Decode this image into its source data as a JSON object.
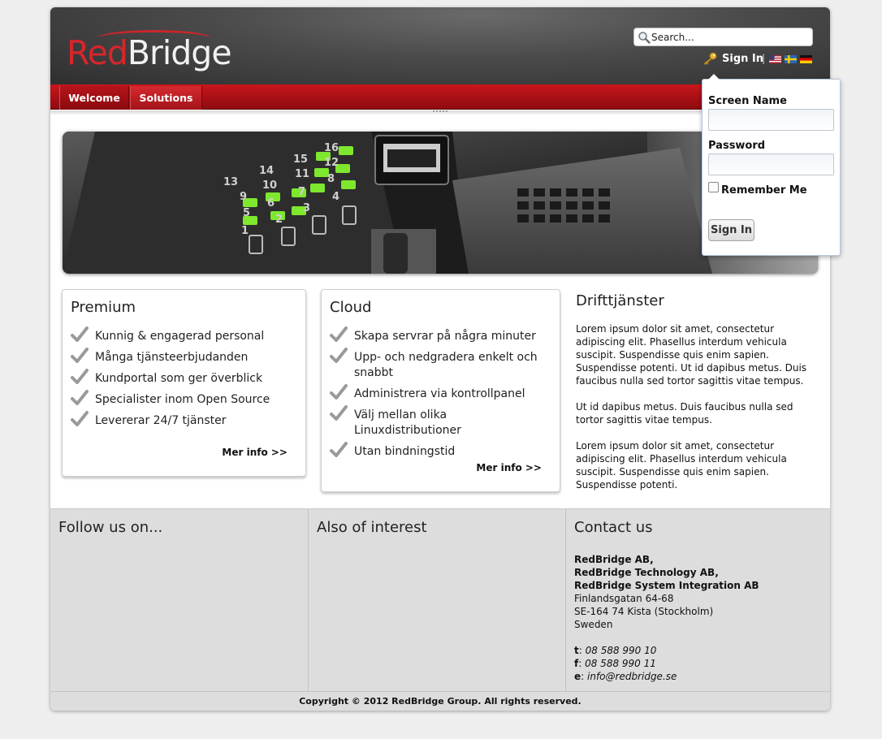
{
  "header": {
    "logo_red": "Red",
    "logo_white": "Bridge",
    "search_placeholder": "Search...",
    "signin_label": "Sign In",
    "separator": "|"
  },
  "nav": {
    "items": [
      {
        "label": "Welcome"
      },
      {
        "label": "Solutions"
      }
    ]
  },
  "cards": {
    "premium": {
      "title": "Premium",
      "items": [
        "Kunnig & engagerad personal",
        "Många tjänsteerbjudanden",
        "Kundportal som ger överblick",
        "Specialister inom Open Source",
        "Levererar 24/7 tjänster"
      ],
      "more": "Mer info >>"
    },
    "cloud": {
      "title": "Cloud",
      "items": [
        "Skapa servrar på några minuter",
        "Upp- och nedgradera enkelt och snabbt",
        "Administrera via kontrollpanel",
        "Välj mellan olika Linuxdistributioner",
        "Utan bindningstid"
      ],
      "more": "Mer info >>"
    }
  },
  "drift": {
    "title": "Drifttjänster",
    "paragraphs": [
      "Lorem ipsum dolor sit amet, consectetur adipiscing elit. Phasellus interdum vehicula suscipit. Suspendisse quis enim sapien. Suspendisse potenti. Ut id dapibus metus. Duis faucibus nulla sed tortor sagittis vitae tempus.",
      "Ut id dapibus metus. Duis faucibus nulla sed tortor sagittis vitae tempus.",
      "Lorem ipsum dolor sit amet, consectetur adipiscing elit. Phasellus interdum vehicula suscipit. Suspendisse quis enim sapien. Suspendisse potenti."
    ]
  },
  "footer": {
    "follow_title": "Follow us on...",
    "interest_title": "Also of interest",
    "contact_title": "Contact us",
    "companies": [
      "RedBridge AB,",
      "RedBridge Technology AB,",
      "RedBridge System Integration AB"
    ],
    "address": [
      "Finlandsgatan 64-68",
      "SE-164 74 Kista (Stockholm)",
      "Sweden"
    ],
    "phone_label": "t",
    "phone": "08 588 990 10",
    "fax_label": "f",
    "fax": "08 588 990 11",
    "email_label": "e",
    "email": "info@redbridge.se",
    "copyright": "Copyright © 2012 RedBridge Group. All rights reserved."
  },
  "login": {
    "screen_name_label": "Screen Name",
    "password_label": "Password",
    "remember_label": "Remember Me",
    "signin_button": "Sign In"
  },
  "hero_labels": {
    "numbers_top": [
      "13",
      "14",
      "15",
      "16"
    ],
    "numbers_mid": [
      "9",
      "10",
      "11",
      "12"
    ],
    "numbers_low": [
      "5",
      "6",
      "7",
      "8"
    ],
    "numbers_bottom": [
      "1",
      "2",
      "3",
      "4"
    ]
  },
  "colors": {
    "brand_red": "#d6262c",
    "nav_red": "#b5141a",
    "footer_gray": "#dddddd"
  }
}
